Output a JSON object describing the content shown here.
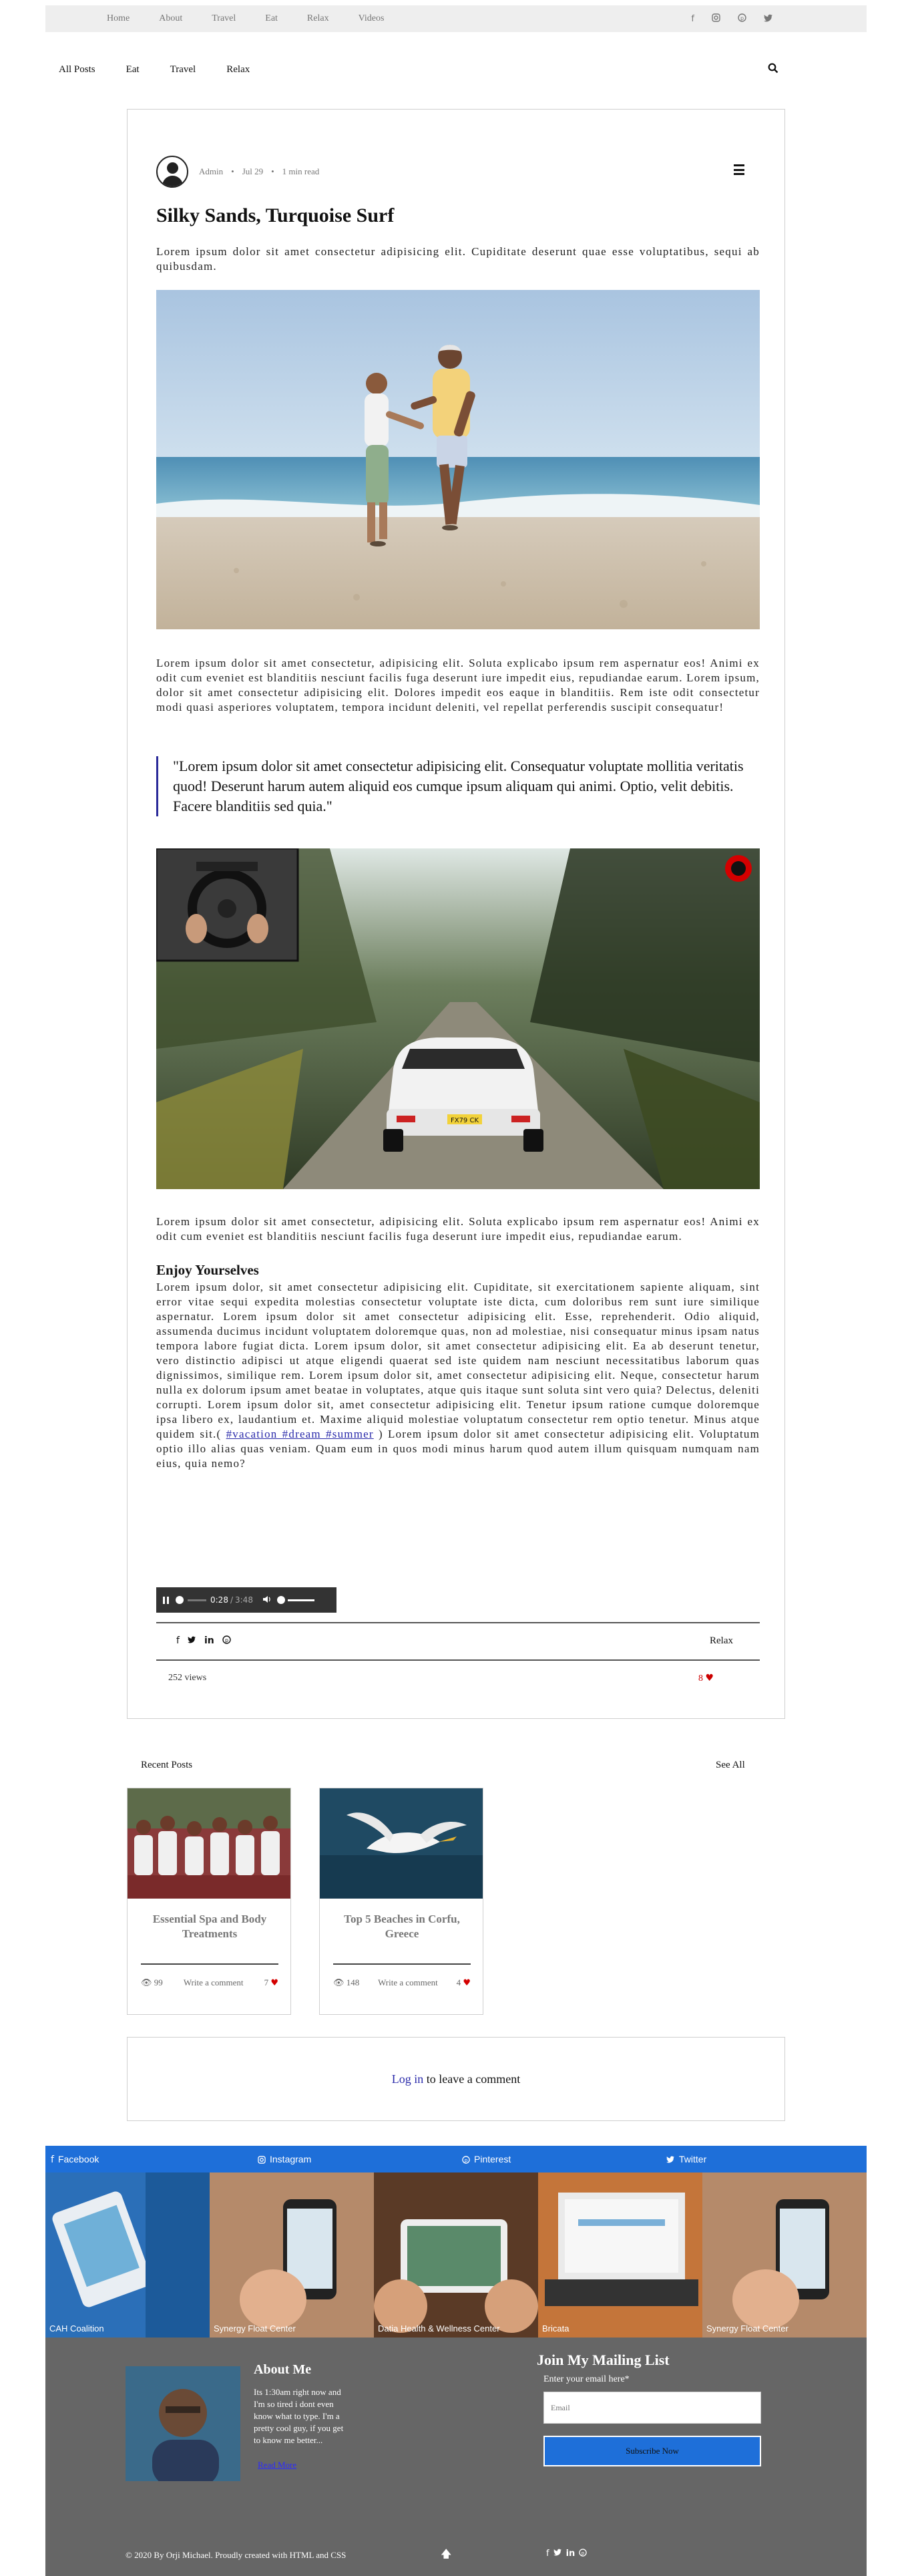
{
  "topnav": {
    "links": [
      "Home",
      "About",
      "Travel",
      "Eat",
      "Relax",
      "Videos"
    ],
    "social_icons": [
      "facebook-icon",
      "instagram-icon",
      "pinterest-icon",
      "twitter-icon"
    ]
  },
  "subnav": {
    "links": [
      "All Posts",
      "Eat",
      "Travel",
      "Relax"
    ],
    "search_icon": "search-icon"
  },
  "post": {
    "author": "Admin",
    "date": "Jul 29",
    "read_time": "1 min read",
    "title": "Silky Sands, Turquoise Surf",
    "intro": "Lorem ipsum dolor sit amet consectetur adipisicing elit. Cupiditate deserunt quae esse voluptatibus, sequi ab quibusdam.",
    "para2": "Lorem ipsum dolor sit amet consectetur, adipisicing elit. Soluta explicabo ipsum rem aspernatur eos! Animi ex odit cum eveniet est blanditiis nesciunt facilis fuga deserunt iure impedit eius, repudiandae earum. Lorem ipsum, dolor sit amet consectetur adipisicing elit. Dolores impedit eos eaque in blanditiis. Rem iste odit consectetur modi quasi asperiores voluptatem, tempora incidunt deleniti, vel repellat perferendis suscipit consequatur!",
    "quote": "\"Lorem ipsum dolor sit amet consectetur adipisicing elit. Consequatur voluptate mollitia veritatis quod! Deserunt harum autem aliquid eos cumque ipsum aliquam qui animi. Optio, velit debitis. Facere blanditiis sed quia.\"",
    "video_plate": "FX79 CK",
    "para3": "Lorem ipsum dolor sit amet consectetur, adipisicing elit. Soluta explicabo ipsum rem aspernatur eos! Animi ex odit cum eveniet est blanditiis nesciunt facilis fuga deserunt iure impedit eius, repudiandae earum.",
    "section_heading": "Enjoy Yourselves",
    "para4a": "Lorem ipsum dolor, sit amet consectetur adipisicing elit. Cupiditate, sit exercitationem sapiente aliquam, sint error vitae sequi expedita molestias consectetur voluptate iste dicta, cum doloribus rem sunt iure similique aspernatur. Lorem ipsum dolor sit amet consectetur adipisicing elit. Esse, reprehenderit. Odio aliquid, assumenda ducimus incidunt voluptatem doloremque quas, non ad molestiae, nisi consequatur minus ipsam natus tempora labore fugiat dicta. Lorem ipsum dolor, sit amet consectetur adipisicing elit. Ea ab deserunt tenetur, vero distinctio adipisci ut atque eligendi quaerat sed iste quidem nam nesciunt necessitatibus laborum quas dignissimos, similique rem. Lorem ipsum dolor sit, amet consectetur adipisicing elit. Neque, consectetur harum nulla ex dolorum ipsum amet beatae in voluptates, atque quis itaque sunt soluta sint vero quia? Delectus, deleniti corrupti. Lorem ipsum dolor sit, amet consectetur adipisicing elit. Tenetur ipsum ratione cumque doloremque ipsa libero ex, laudantium et. Maxime aliquid molestiae voluptatum consectetur rem optio tenetur. Minus atque quidem sit.(",
    "hashtags": "#vacation #dream #summer",
    "para4b": ") Lorem ipsum dolor sit amet consectetur adipisicing elit. Voluptatum optio illo alias quas veniam. Quam eum in quos modi minus harum quod autem illum quisquam numquam nam eius, quia nemo?",
    "audio_current": "0:28",
    "audio_total": "3:48",
    "audio_progress_pct": 12,
    "category": "Relax",
    "views": "252 views",
    "likes": "8"
  },
  "recent": {
    "title": "Recent Posts",
    "see_all": "See All",
    "cards": [
      {
        "title": "Essential Spa and Body Treatments",
        "views": "99",
        "comment": "Write a comment",
        "likes": "7"
      },
      {
        "title": "Top 5 Beaches in Corfu, Greece",
        "views": "148",
        "comment": "Write a comment",
        "likes": "4"
      }
    ]
  },
  "comments": {
    "login_link": "Log in",
    "login_rest": " to leave a comment"
  },
  "footer": {
    "bar": [
      "Facebook",
      "Instagram",
      "Pinterest",
      "Twitter"
    ],
    "tiles": [
      "CAH Coalition",
      "Synergy Float Center",
      "Datia Health & Wellness Center",
      "Bricata",
      "Synergy Float Center"
    ],
    "about_heading": "About Me",
    "about_text": "Its 1:30am right now and I'm so tired i dont even know what to type. I'm a pretty cool guy, if you get to know me better...",
    "read_more": "Read More",
    "mailing_heading": "Join My Mailing List",
    "email_label": "Enter your email here*",
    "email_placeholder": "Email",
    "subscribe": "Subscribe Now",
    "copyright": "© 2020 By Orji Michael. Proudly created with HTML and CSS"
  },
  "colors": {
    "accent_blue": "#1e6fd9",
    "footer_bg": "#666666",
    "heart": "#d40000",
    "link": "#2a2aaa"
  }
}
